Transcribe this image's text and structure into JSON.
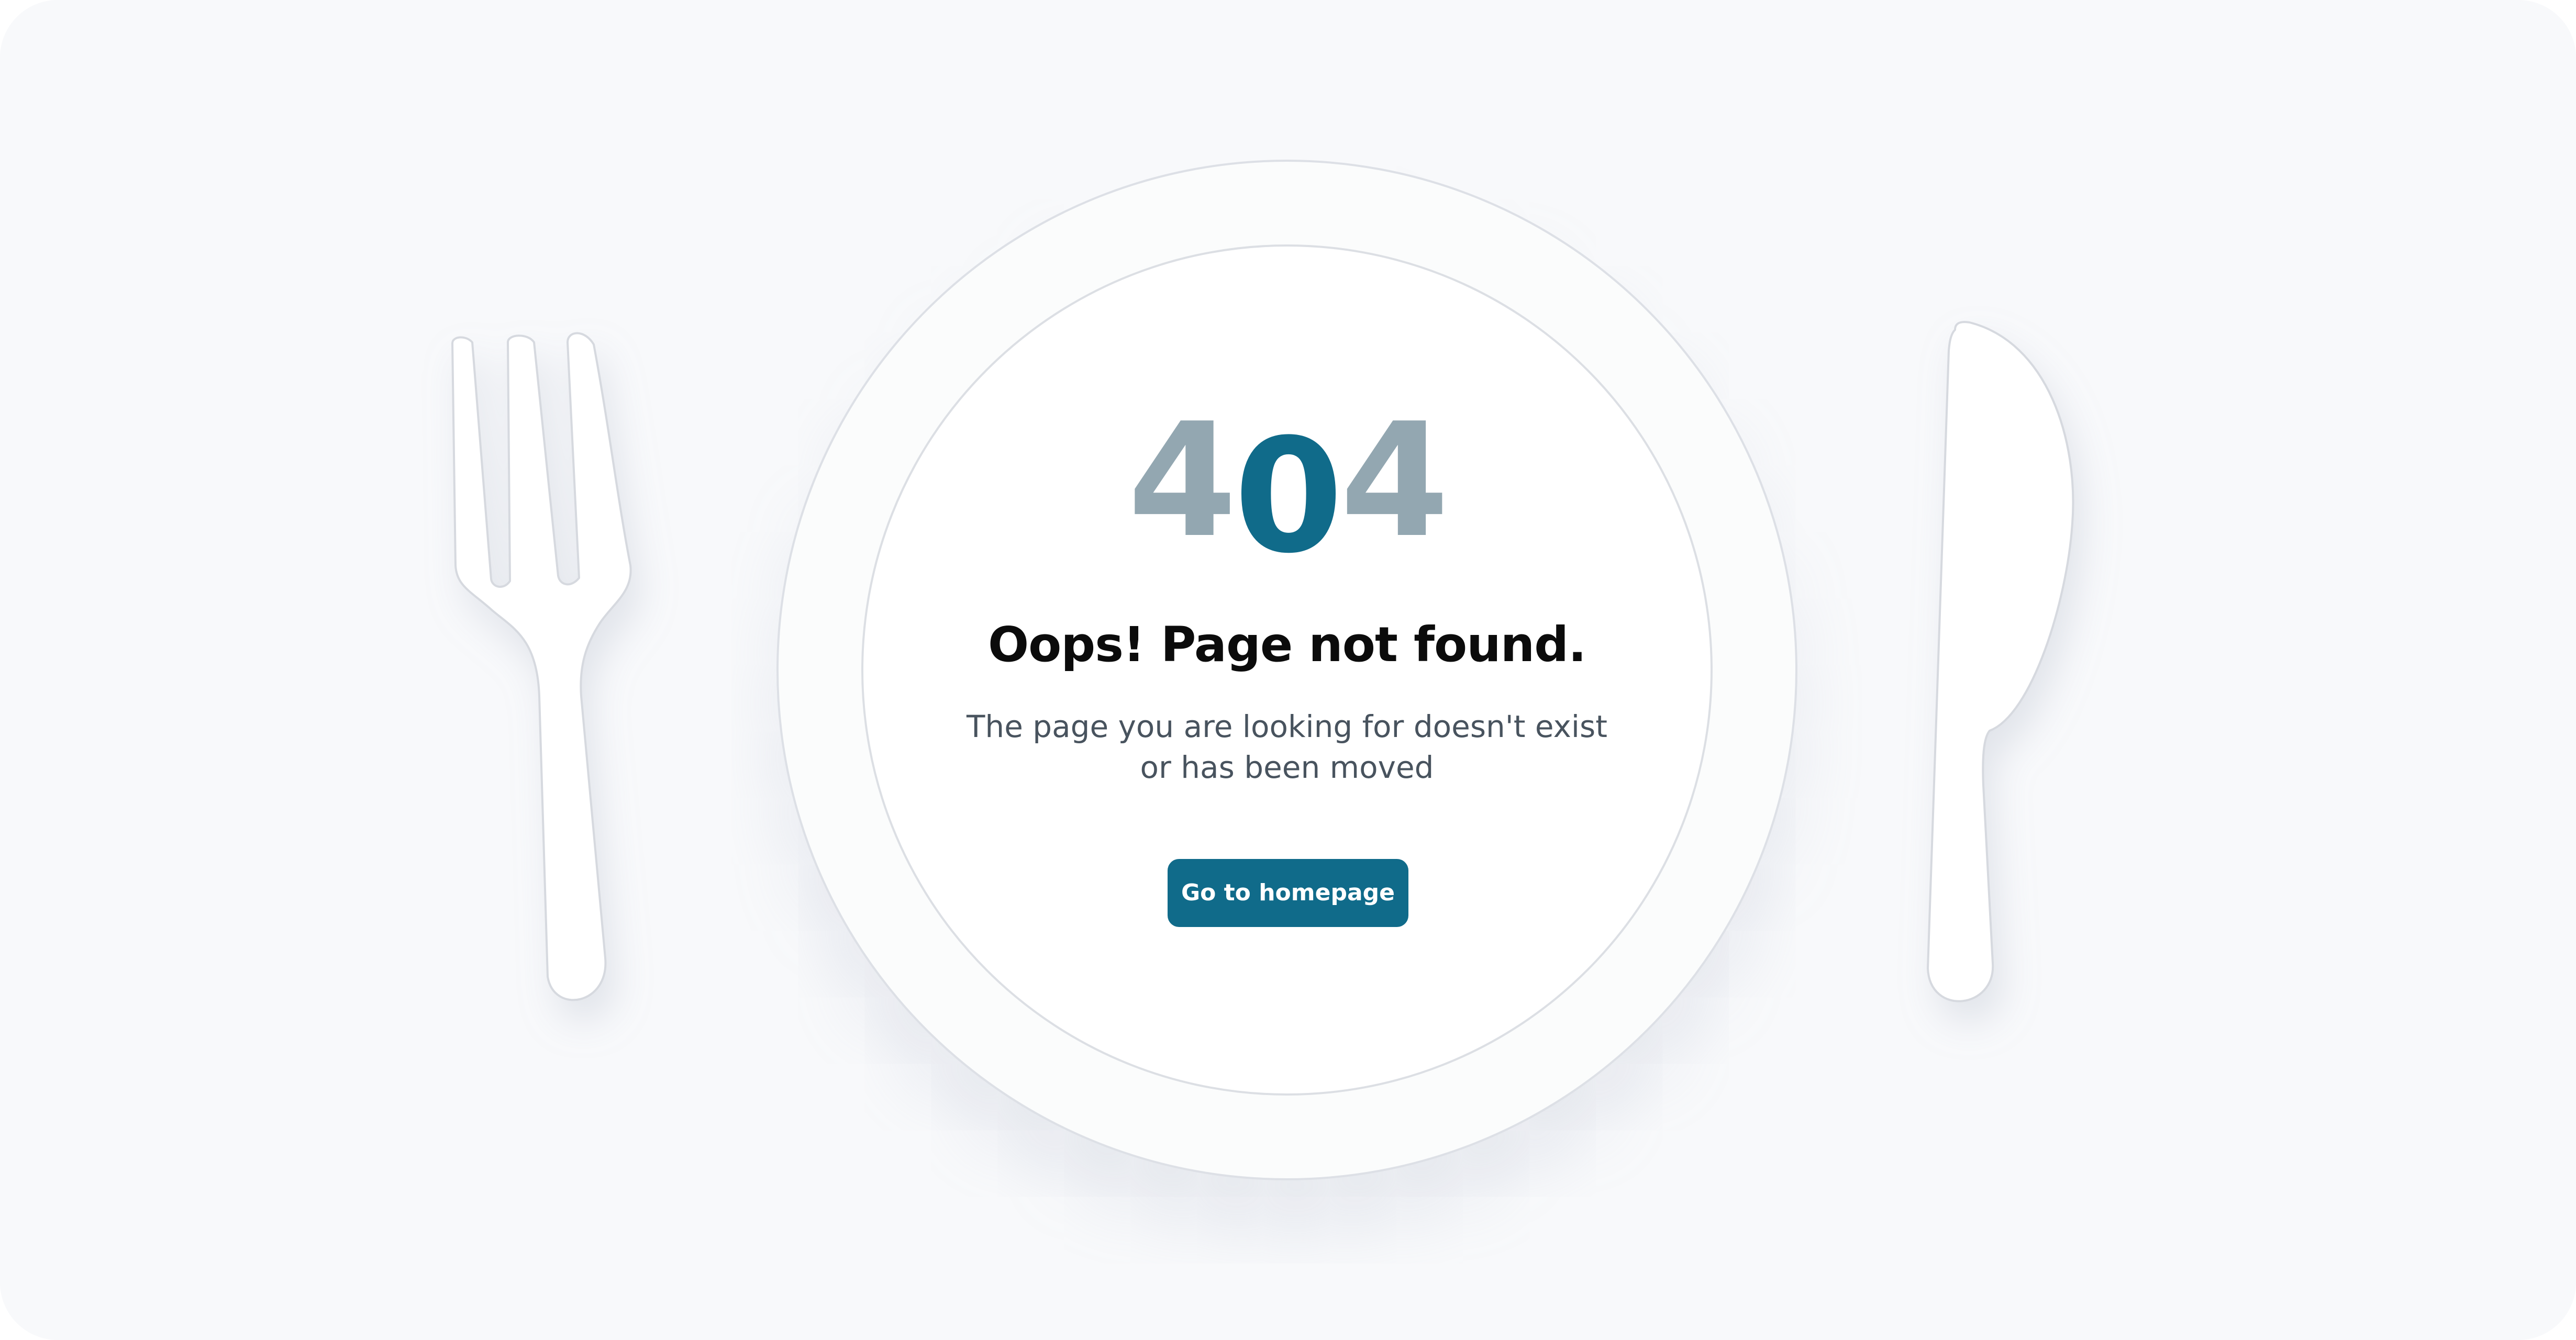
{
  "error": {
    "code_digits": [
      "4",
      "0",
      "4"
    ],
    "title": "Oops! Page not found.",
    "message": "The page you are looking for doesn't exist or has been moved"
  },
  "actions": {
    "home_label": "Go to homepage"
  },
  "decor": {
    "left_icon": "fork-icon",
    "right_icon": "knife-icon",
    "center": "plate"
  },
  "colors": {
    "brand": "#106b8a",
    "digit_muted": "#93a7b1",
    "background": "#f8f9fb",
    "title": "#0b0b0b",
    "message": "#48535e"
  }
}
